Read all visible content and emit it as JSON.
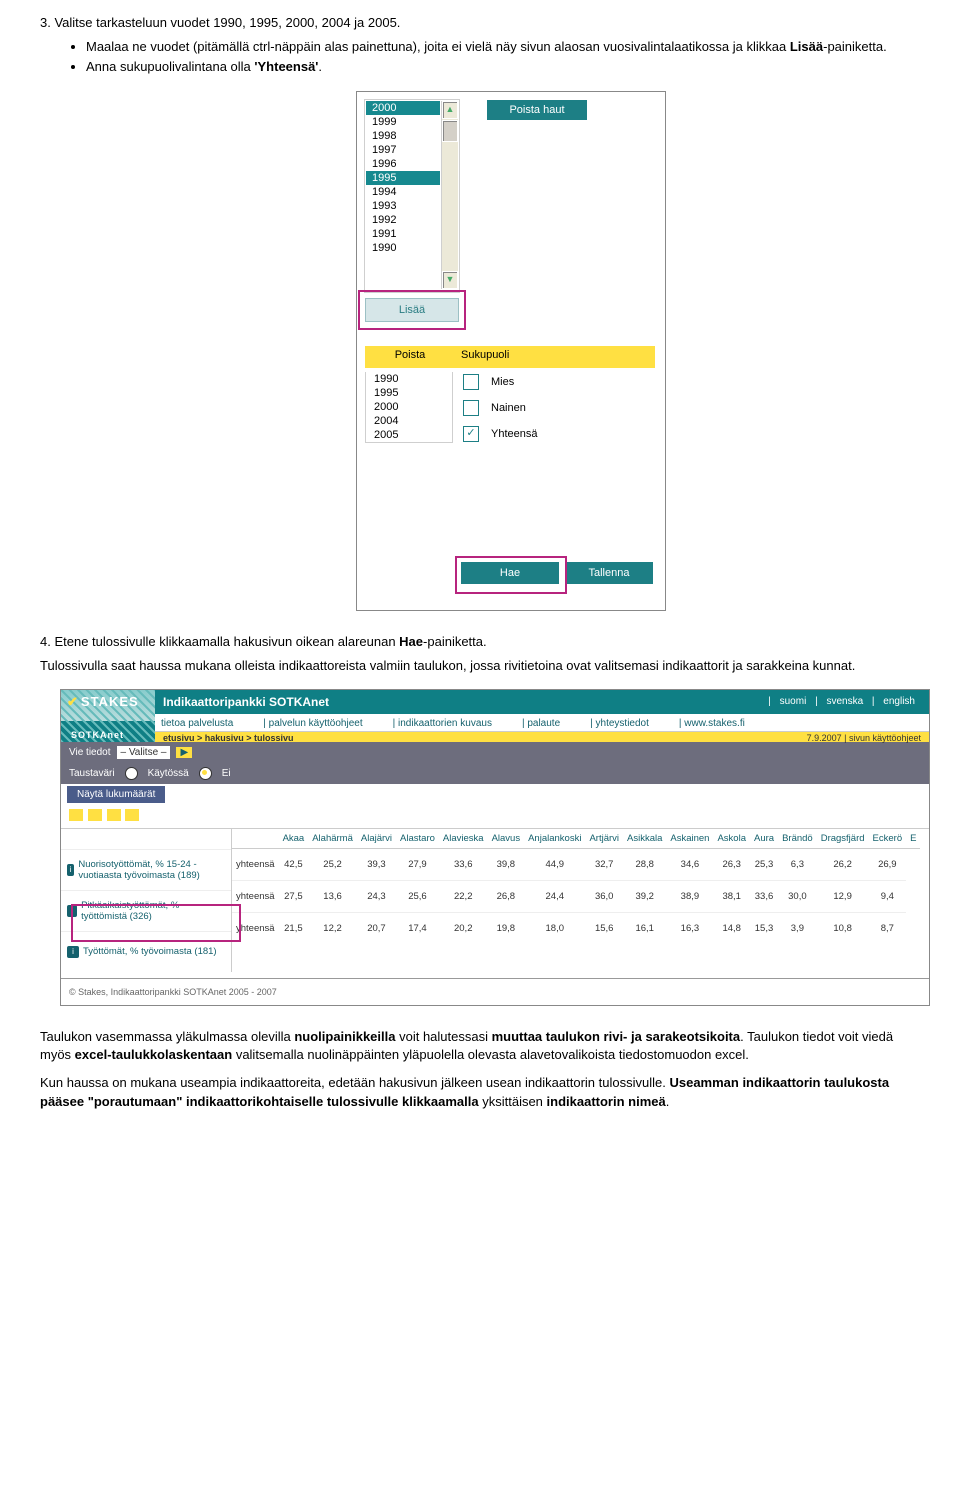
{
  "instr3": "3. Valitse tarkasteluun vuodet 1990, 1995, 2000, 2004 ja 2005.",
  "bullets1": [
    {
      "pre": "Maalaa ne vuodet (pitämällä ctrl-näppäin alas painettuna), joita ei vielä näy sivun alaosan vuosivalintalaatikossa ja klikkaa ",
      "b": "Lisää",
      "post": "-painiketta."
    },
    {
      "pre": "Anna sukupuolivalintana olla ",
      "b": "'Yhteensä'",
      "post": "."
    }
  ],
  "yearlist": [
    "2000",
    "1999",
    "1998",
    "1997",
    "1996",
    "1995",
    "1994",
    "1993",
    "1992",
    "1991",
    "1990"
  ],
  "yearlist_selected": [
    0,
    5
  ],
  "poistahaut": "Poista haut",
  "lisaa": "Lisää",
  "poista": "Poista",
  "sukupuoli": "Sukupuoli",
  "selyears": [
    "1990",
    "1995",
    "2000",
    "2004",
    "2005"
  ],
  "genders": [
    {
      "label": "Mies",
      "checked": false
    },
    {
      "label": "Nainen",
      "checked": false
    },
    {
      "label": "Yhteensä",
      "checked": true
    }
  ],
  "hae": "Hae",
  "tallenna": "Tallenna",
  "instr4_pre": "4. Etene tulossivulle klikkaamalla hakusivun oikean alareunan ",
  "instr4_b": "Hae",
  "instr4_post": "-painiketta.",
  "instr4_p": "Tulossivulla saat haussa mukana olleista indikaattoreista valmiin taulukon, jossa rivitietoina ovat valitsemasi indikaattorit ja sarakkeina kunnat.",
  "s2": {
    "title": "Indikaattoripankki SOTKAnet",
    "langs": [
      "suomi",
      "svenska",
      "english"
    ],
    "menu": [
      "tietoa palvelusta",
      "palvelun käyttöohjeet",
      "indikaattorien kuvaus",
      "palaute",
      "yhteystiedot",
      "www.stakes.fi"
    ],
    "bc_left": "etusivu > hakusivu > tulossivu",
    "bc_right": "7.9.2007 | sivun käyttöohjeet",
    "vie": "Vie tiedot",
    "valitse": "– Valitse –",
    "tausta": "Taustaväri",
    "kaytossa": "Käytössä",
    "ei": "Ei",
    "nayta": "Näytä lukumäärät",
    "cols": [
      "Akaa",
      "Alahärmä",
      "Alajärvi",
      "Alastaro",
      "Alavieska",
      "Alavus",
      "Anjalankoski",
      "Artjärvi",
      "Asikkala",
      "Askainen",
      "Askola",
      "Aura",
      "Brändö",
      "Dragsfjärd",
      "Eckerö",
      "E"
    ],
    "rows": [
      {
        "label": "Nuorisotyöttömät, % 15-24 -vuotiaasta työvoimasta (189)",
        "row": "yhteensä",
        "vals": [
          "42,5",
          "25,2",
          "39,3",
          "27,9",
          "33,6",
          "39,8",
          "44,9",
          "32,7",
          "28,8",
          "34,6",
          "26,3",
          "25,3",
          "6,3",
          "26,2",
          "26,9"
        ]
      },
      {
        "label": "Pitkäaikaistyöttömät, % työttömistä (326)",
        "row": "yhteensä",
        "vals": [
          "27,5",
          "13,6",
          "24,3",
          "25,6",
          "22,2",
          "26,8",
          "24,4",
          "36,0",
          "39,2",
          "38,9",
          "38,1",
          "33,6",
          "30,0",
          "12,9",
          "9,4"
        ]
      },
      {
        "label": "Työttömät, % työvoimasta (181)",
        "row": "yhteensä",
        "vals": [
          "21,5",
          "12,2",
          "20,7",
          "17,4",
          "20,2",
          "19,8",
          "18,0",
          "15,6",
          "16,1",
          "16,3",
          "14,8",
          "15,3",
          "3,9",
          "10,8",
          "8,7"
        ]
      }
    ],
    "footer": "© Stakes, Indikaattoripankki SOTKAnet 2005 - 2007"
  },
  "p_after1_pre": "Taulukon vasemmassa yläkulmassa olevilla ",
  "p_after1_b1": "nuolipainikkeilla",
  "p_after1_mid1": " voit halutessasi ",
  "p_after1_b2": "muuttaa taulukon rivi- ja sarakeotsikoita",
  "p_after1_mid2": ". Taulukon tiedot voit viedä myös ",
  "p_after1_b3": "excel-taulukkolaskentaan",
  "p_after1_post": " valitsemalla nuolinäppäinten yläpuolella olevasta alavetovalikoista tiedostomuodon excel.",
  "p_after2_pre": "Kun haussa on mukana useampia indikaattoreita, edetään hakusivun jälkeen usean indikaattorin tulossivulle. ",
  "p_after2_b1": "Useamman indikaattorin taulukosta pääsee \"porautumaan\" indikaattorikohtaiselle tulossivulle klikkaamalla",
  "p_after2_mid": " yksittäisen ",
  "p_after2_b2": "indikaattorin nimeä",
  "p_after2_post": "."
}
